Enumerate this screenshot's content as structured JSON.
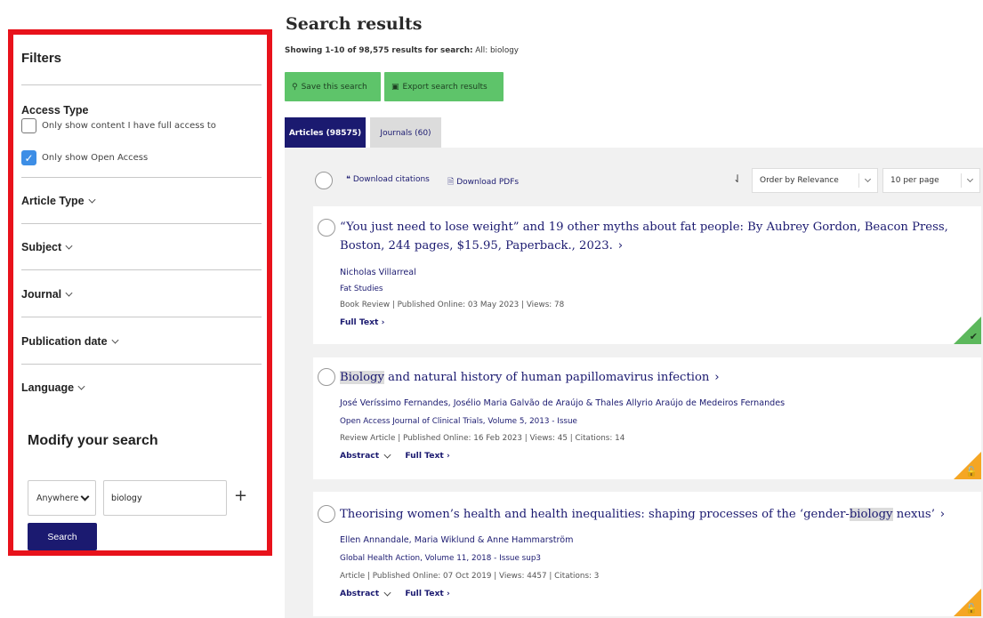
{
  "sidebar": {
    "title": "Filters",
    "access_type_label": "Access Type",
    "checkboxes": [
      {
        "label": "Only show content I have full access to",
        "checked": false
      },
      {
        "label": "Only show Open Access",
        "checked": true
      }
    ],
    "facets": [
      "Article Type",
      "Subject",
      "Journal",
      "Publication date",
      "Language"
    ],
    "modify_title": "Modify your search",
    "field_select": "Anywhere",
    "search_value": "biology",
    "add_label": "+",
    "search_button": "Search"
  },
  "header": {
    "title": "Search results",
    "showing_prefix": "Showing 1-10 of 98,575 results for search:",
    "showing_query": " All: biology"
  },
  "actions": {
    "save": "Save this search",
    "export": "Export search results"
  },
  "tabs": [
    {
      "label": "Articles (98575)",
      "active": true
    },
    {
      "label": "Journals (60)",
      "active": false
    }
  ],
  "toolbar": {
    "download_citations": "Download citations",
    "download_pdfs": "Download PDFs",
    "order": "Order by Relevance",
    "per_page": "10 per page"
  },
  "results": [
    {
      "title_line1": "“You just need to lose weight” and 19 other myths about fat people: By Aubrey Gordon, Beacon Press,",
      "title_line2": "Boston, 244 pages, $15.95, Paperback., 2023.",
      "authors": "Nicholas Villarreal",
      "journal": "Fat Studies",
      "meta": "Book Review | Published Online: 03 May 2023 | Views: 78",
      "full_text": "Full Text ›",
      "access": "full"
    },
    {
      "title_highlight": "Biology",
      "title_rest": " and natural history of human papillomavirus infection",
      "authors": "José Veríssimo Fernandes, Josélio Maria Galvão de Araújo & Thales Allyrio Araújo de Medeiros Fernandes",
      "journal": "Open Access Journal of Clinical Trials, Volume 5, 2013 - Issue",
      "meta": "Review Article | Published Online: 16 Feb 2023 | Views: 45 | Citations: 14",
      "abstract": "Abstract",
      "full_text": "Full Text ›",
      "access": "open"
    },
    {
      "title_before": "Theorising women’s health and health inequalities: shaping processes of the ‘gender-",
      "title_highlight": "biology",
      "title_after": " nexus’",
      "authors": "Ellen Annandale, Maria Wiklund & Anne Hammarström",
      "journal": "Global Health Action, Volume 11, 2018 - Issue sup3",
      "meta": "Article | Published Online: 07 Oct 2019 | Views: 4457 | Citations: 3",
      "abstract": "Abstract",
      "full_text": "Full Text ›",
      "access": "open"
    }
  ],
  "icons": {
    "check": "check-icon",
    "lock": "open-lock-icon"
  },
  "colors": {
    "accent_navy": "#1b1a70",
    "action_green": "#5ec46a",
    "open_access_orange": "#f5a623",
    "full_access_green": "#5cb85c",
    "highlight_border": "#e8121b"
  }
}
